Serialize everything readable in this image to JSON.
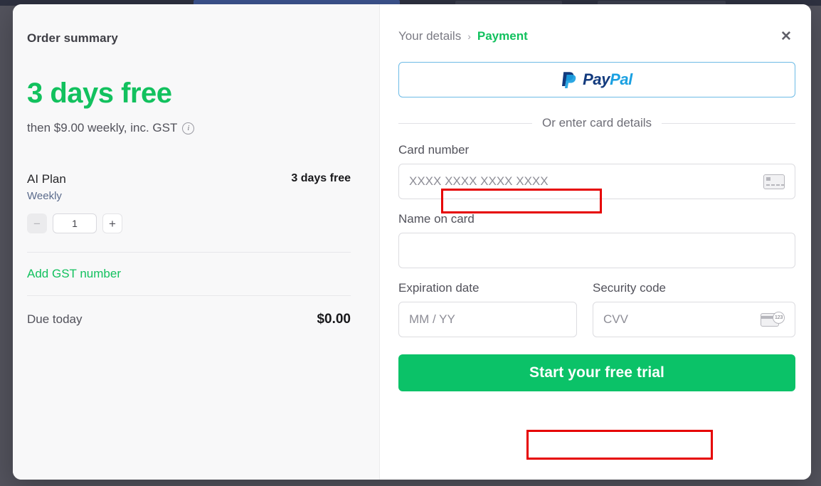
{
  "background_page": {
    "visible_sliver": true,
    "strip_color": "#2e3140",
    "button_color": "#3d548f"
  },
  "modal": {
    "close_icon_label": "✕"
  },
  "order_summary": {
    "title": "Order summary",
    "trial_headline": "3 days free",
    "trial_subtext": "then $9.00 weekly, inc. GST",
    "info_icon_label": "i",
    "plan": {
      "name": "AI Plan",
      "price": "3 days free",
      "period": "Weekly"
    },
    "quantity": {
      "decrease_label": "−",
      "value": "1",
      "increase_label": "+"
    },
    "add_gst_label": "Add GST number",
    "due_label": "Due today",
    "due_value": "$0.00"
  },
  "payment": {
    "breadcrumb": {
      "previous": "Your details",
      "separator": "›",
      "current": "Payment"
    },
    "paypal": {
      "mark": "P",
      "text_pay": "Pay",
      "text_pal": "Pal"
    },
    "divider_label": "Or enter card details",
    "fields": {
      "card_number": {
        "label": "Card number",
        "value": "",
        "placeholder": "XXXX XXXX XXXX XXXX",
        "icon": "credit-card-icon"
      },
      "name_on_card": {
        "label": "Name on card",
        "value": "",
        "placeholder": ""
      },
      "expiration": {
        "label": "Expiration date",
        "value": "",
        "placeholder": "MM / YY"
      },
      "security_code": {
        "label": "Security code",
        "value": "",
        "placeholder": "CVV",
        "icon": "cvv-card-icon",
        "icon_digits": "123"
      }
    },
    "submit_label": "Start your free trial"
  },
  "colors": {
    "accent_green": "#12c15e",
    "button_green": "#0bc268",
    "paypal_dark": "#123a7d",
    "paypal_light": "#1aa0e1",
    "annotation_red": "#e60000",
    "backdrop": "#53535d"
  }
}
